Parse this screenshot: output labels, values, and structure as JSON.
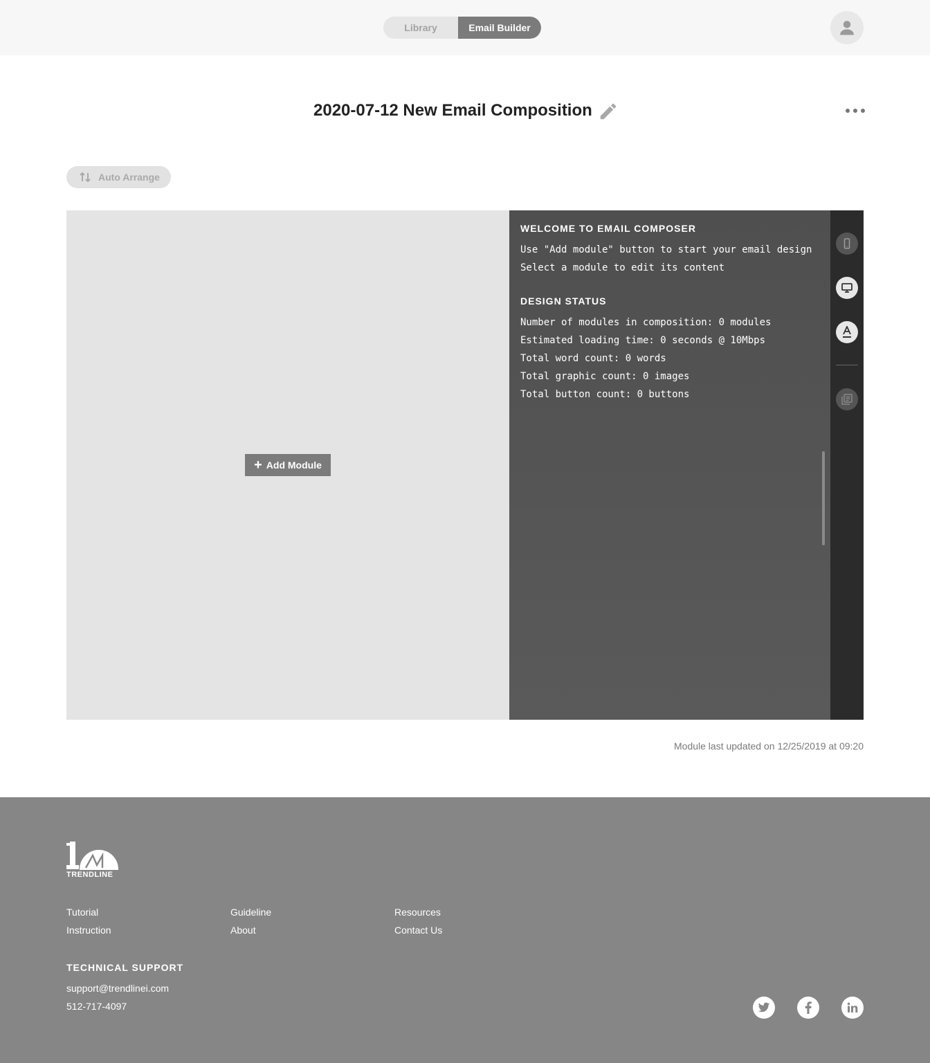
{
  "header": {
    "tabs": [
      {
        "label": "Library",
        "active": false
      },
      {
        "label": "Email Builder",
        "active": true
      }
    ],
    "avatar_icon": "user-icon"
  },
  "title_bar": {
    "title": "2020-07-12 New Email Composition",
    "edit_icon": "pencil-icon",
    "more_icon": "more-horizontal-icon"
  },
  "toolbar": {
    "auto_arrange_label": "Auto Arrange",
    "auto_arrange_icon": "swap-vertical-icon"
  },
  "canvas": {
    "add_module_label": "Add Module"
  },
  "info_panel": {
    "welcome_heading": "WELCOME TO EMAIL COMPOSER",
    "welcome_lines": [
      "Use \"Add module\" button to start your email design",
      "Select a module to edit its content"
    ],
    "status_heading": "DESIGN STATUS",
    "status_lines": [
      "Number of modules in composition: 0 modules",
      "Estimated loading time: 0 seconds @ 10Mbps",
      "Total word count: 0 words",
      "Total graphic count: 0 images",
      "Total button count: 0 buttons"
    ]
  },
  "tool_rail": {
    "tools": [
      "mobile-icon",
      "desktop-icon",
      "text-format-icon",
      "copy-list-icon"
    ]
  },
  "status_footer": {
    "updated_text": "Module last updated on 12/25/2019 at 09:20"
  },
  "footer": {
    "logo_text": "TRENDLINE",
    "links": [
      [
        "Tutorial",
        "Instruction"
      ],
      [
        "Guideline",
        "About"
      ],
      [
        "Resources",
        "Contact Us"
      ]
    ],
    "support_heading": "TECHNICAL SUPPORT",
    "support_email": "support@trendlinei.com",
    "support_phone": "512-717-4097",
    "social": [
      "twitter-icon",
      "facebook-icon",
      "linkedin-icon"
    ]
  },
  "colors": {
    "header_bg": "#f7f7f7",
    "active_tab": "#7b7b7b",
    "canvas_bg": "#e4e4e4",
    "panel_bg": "#555555",
    "rail_bg": "#2b2b2b",
    "footer_bg": "#868686"
  }
}
